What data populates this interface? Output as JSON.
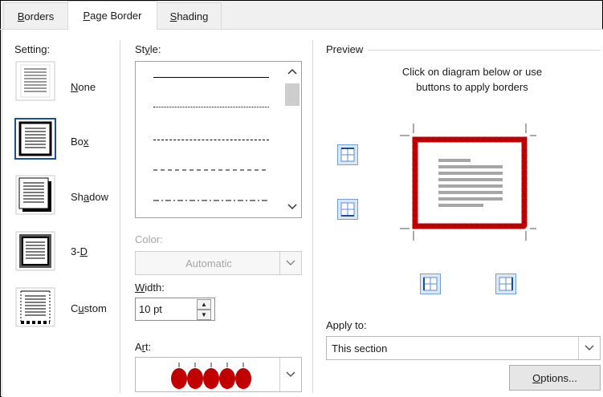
{
  "tabs": [
    {
      "pre": "",
      "key": "B",
      "post": "orders",
      "active": false
    },
    {
      "pre": "",
      "key": "P",
      "post": "age Border",
      "active": true
    },
    {
      "pre": "",
      "key": "S",
      "post": "hading",
      "active": false
    }
  ],
  "setting": {
    "label": "Setting:",
    "options": [
      {
        "pre": "",
        "key": "N",
        "post": "one",
        "selected": false
      },
      {
        "pre": "Bo",
        "key": "x",
        "post": "",
        "selected": true
      },
      {
        "pre": "Sh",
        "key": "a",
        "post": "dow",
        "selected": false
      },
      {
        "pre": "3-",
        "key": "D",
        "post": "",
        "selected": false
      },
      {
        "pre": "C",
        "key": "u",
        "post": "stom",
        "selected": false
      }
    ]
  },
  "style": {
    "label_pre": "St",
    "label_key": "y",
    "label_post": "le:",
    "line_styles": [
      "solid",
      "dotted",
      "dashed-fine",
      "dashed",
      "dash-dot"
    ]
  },
  "color": {
    "label": "Color:",
    "value": "Automatic"
  },
  "width": {
    "label_pre": "",
    "label_key": "W",
    "label_post": "idth:",
    "value": "10 pt"
  },
  "art": {
    "label_pre": "A",
    "label_key": "r",
    "label_post": "t:",
    "motif": "red-apples"
  },
  "preview": {
    "title": "Preview",
    "instruction_line1": "Click on diagram below or use",
    "instruction_line2": "buttons to apply borders",
    "border_color": "#c00000"
  },
  "apply_to": {
    "label": "Apply to:",
    "value": "This section"
  },
  "options_button": {
    "pre": "",
    "key": "O",
    "post": "ptions..."
  }
}
